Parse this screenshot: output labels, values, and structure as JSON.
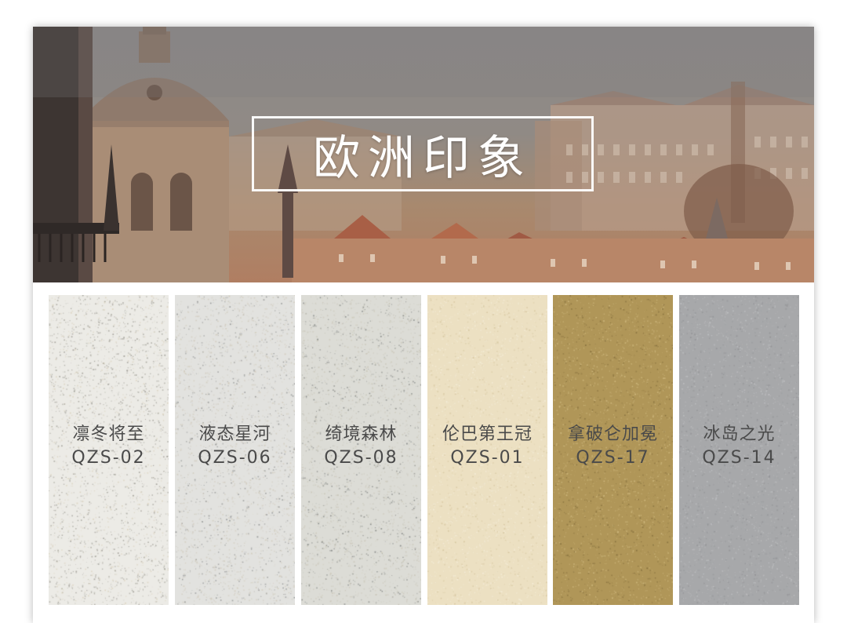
{
  "banner": {
    "title": "欧洲印象"
  },
  "swatches": [
    {
      "name": "凛冬将至",
      "code": "QZS-02",
      "base": "#ecebe6",
      "dot1": "#d9cfb8",
      "dot2": "#9a9890"
    },
    {
      "name": "液态星河",
      "code": "QZS-06",
      "base": "#e2e2df",
      "dot1": "#8a8c8c",
      "dot2": "#cfc8b8"
    },
    {
      "name": "绮境森林",
      "code": "QZS-08",
      "base": "#dcdcd6",
      "dot1": "#7d807e",
      "dot2": "#c9c5b6"
    },
    {
      "name": "伦巴第王冠",
      "code": "QZS-01",
      "base": "#ece0c2",
      "dot1": "#d3c29a",
      "dot2": "#f6efdc"
    },
    {
      "name": "拿破仑加冕",
      "code": "QZS-17",
      "base": "#b09658",
      "dot1": "#7f6a3a",
      "dot2": "#d3bd83"
    },
    {
      "name": "冰岛之光",
      "code": "QZS-14",
      "base": "#a7a8aa",
      "dot1": "#8e8f92",
      "dot2": "#c2c3c5"
    }
  ]
}
